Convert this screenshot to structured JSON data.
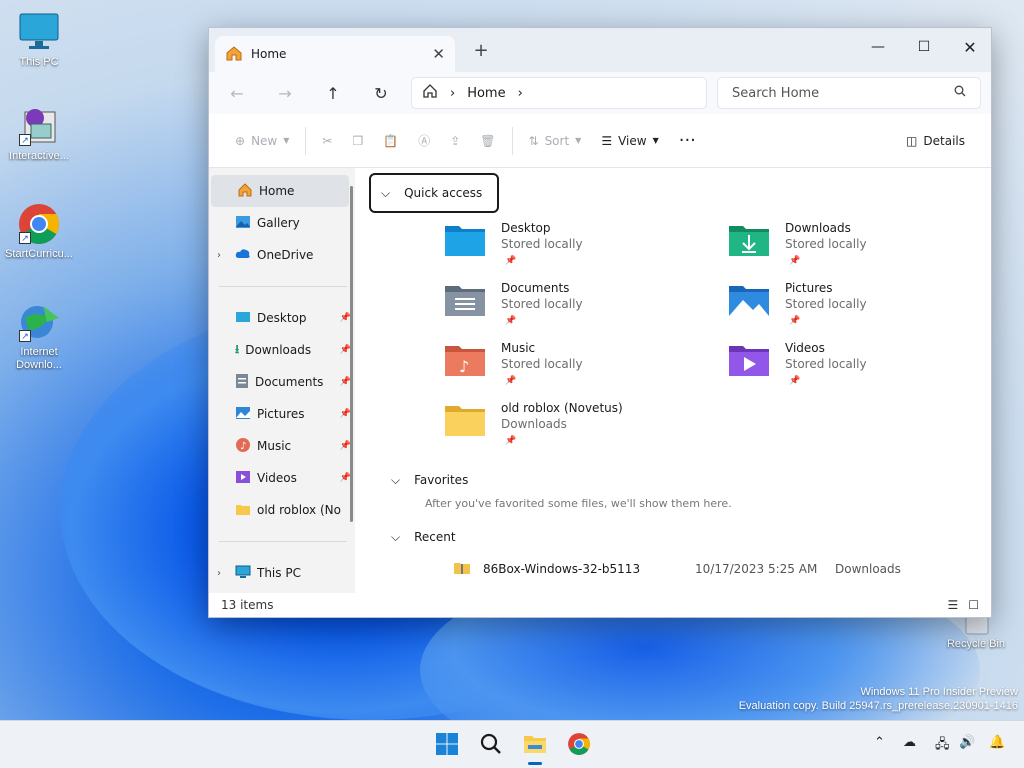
{
  "desktop": {
    "icons": [
      {
        "label": "This PC"
      },
      {
        "label": "Interactive..."
      },
      {
        "label": "StartCurricu..."
      },
      {
        "label": "Internet Downlo..."
      },
      {
        "label": "Recycle Bin"
      }
    ],
    "watermark_line1": "Windows 11 Pro Insider Preview",
    "watermark_line2": "Evaluation copy. Build 25947.rs_prerelease.230901-1416"
  },
  "window": {
    "tab_title": "Home",
    "nav_back_icon": "back-arrow-icon",
    "breadcrumb": {
      "current": "Home"
    },
    "search": {
      "placeholder": "Search Home"
    },
    "toolbar": {
      "new_label": "New",
      "sort_label": "Sort",
      "view_label": "View",
      "details_label": "Details"
    },
    "nav_pane": {
      "top_items": [
        {
          "label": "Home"
        },
        {
          "label": "Gallery"
        },
        {
          "label": "OneDrive"
        }
      ],
      "pinned_items": [
        {
          "label": "Desktop"
        },
        {
          "label": "Downloads"
        },
        {
          "label": "Documents"
        },
        {
          "label": "Pictures"
        },
        {
          "label": "Music"
        },
        {
          "label": "Videos"
        },
        {
          "label": "old roblox (Novetus)"
        }
      ],
      "bottom_items": [
        {
          "label": "This PC"
        }
      ]
    },
    "quick_access": {
      "title": "Quick access",
      "items": [
        {
          "name": "Desktop",
          "location": "Stored locally"
        },
        {
          "name": "Downloads",
          "location": "Stored locally"
        },
        {
          "name": "Documents",
          "location": "Stored locally"
        },
        {
          "name": "Pictures",
          "location": "Stored locally"
        },
        {
          "name": "Music",
          "location": "Stored locally"
        },
        {
          "name": "Videos",
          "location": "Stored locally"
        },
        {
          "name": "old roblox (Novetus)",
          "location": "Downloads"
        }
      ]
    },
    "favorites": {
      "title": "Favorites",
      "empty_text": "After you've favorited some files, we'll show them here."
    },
    "recent": {
      "title": "Recent",
      "rows": [
        {
          "name": "86Box-Windows-32-b5113",
          "date": "10/17/2023 5:25 AM",
          "location": "Downloads"
        }
      ]
    },
    "status": {
      "item_count": "13 items"
    }
  },
  "colors": {
    "accent": "#0067c0",
    "folder_yellow": "#f6c94a",
    "window_bg": "#ffffff",
    "nav_bg": "#f3f3f3"
  }
}
